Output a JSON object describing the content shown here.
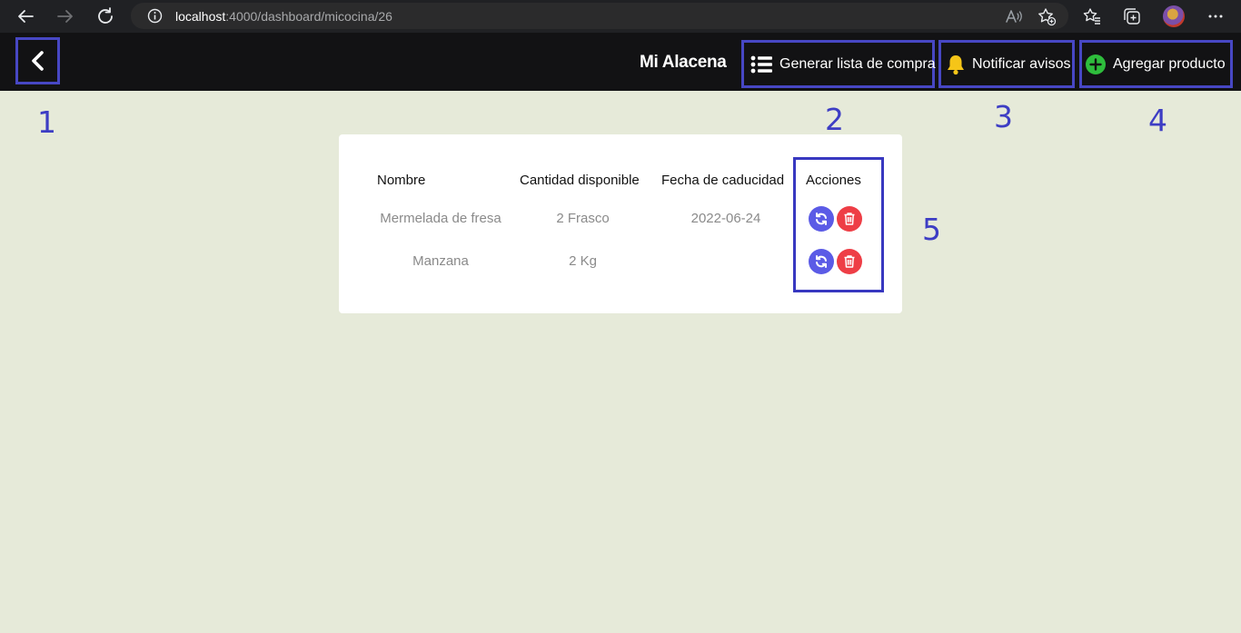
{
  "browser": {
    "url_host": "localhost",
    "url_path": ":4000/dashboard/micocina/26"
  },
  "header": {
    "title": "Mi Alacena",
    "lista_label": "Generar lista de compra",
    "avisos_label": "Notificar avisos",
    "agregar_label": "Agregar producto"
  },
  "annotations": [
    "1",
    "2",
    "3",
    "4",
    "5"
  ],
  "table": {
    "headers": [
      "Nombre",
      "Cantidad disponible",
      "Fecha de caducidad",
      "Acciones"
    ],
    "rows": [
      {
        "nombre": "Mermelada de fresa",
        "cantidad": "2 Frasco",
        "fecha": "2022-06-24"
      },
      {
        "nombre": "Manzana",
        "cantidad": "2 Kg",
        "fecha": ""
      }
    ]
  },
  "colors": {
    "page_bg": "#e6ead9",
    "header_bg": "#121214",
    "annotation": "#3d3dc4",
    "refresh": "#5b5be6",
    "delete": "#ee3e46",
    "add_icon": "#2ebd3c",
    "bell_icon": "#f5c518"
  },
  "icons": [
    "back-arrow-icon",
    "forward-arrow-icon",
    "reload-icon",
    "info-icon",
    "read-aloud-icon",
    "favorite-add-icon",
    "favorites-icon",
    "collections-icon",
    "more-icon",
    "chevron-left-icon",
    "list-icon",
    "bell-icon",
    "plus-circle-icon",
    "refresh-icon",
    "trash-icon"
  ]
}
